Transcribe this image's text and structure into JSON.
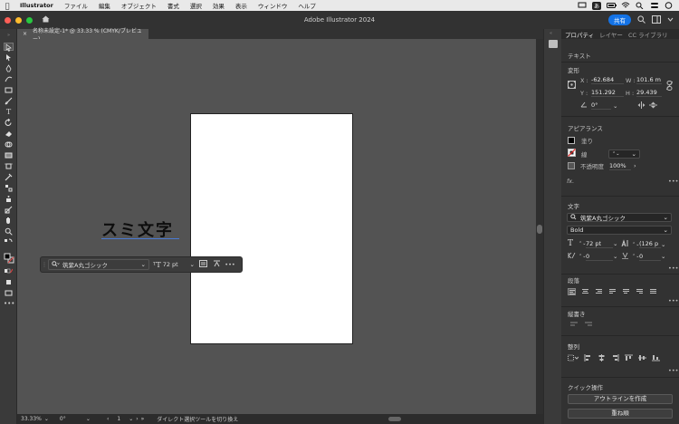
{
  "menubar": {
    "app_name": "Illustrator",
    "items": [
      "ファイル",
      "編集",
      "オブジェクト",
      "書式",
      "選択",
      "効果",
      "表示",
      "ウィンドウ",
      "ヘルプ"
    ],
    "ime": "あ"
  },
  "titlebar": {
    "title": "Adobe Illustrator 2024",
    "share_label": "共有"
  },
  "document": {
    "tab_label": "名称未設定-1* @ 33.33 % (CMYK/プレビュー)",
    "text_content": "スミ文字"
  },
  "context_bar": {
    "font_name": "筑紫A丸ゴシック",
    "font_size": "72 pt"
  },
  "statusbar": {
    "zoom": "33.33%",
    "rotation": "0°",
    "artboard_number": "1",
    "status_text": "ダイレクト選択ツールを切り換え"
  },
  "panel": {
    "tabs": [
      "プロパティ",
      "レイヤー",
      "CC ライブラリ"
    ],
    "object_type": "テキスト",
    "transform": {
      "title": "変形",
      "x_label": "X :",
      "x_value": "-62.684",
      "y_label": "Y :",
      "y_value": "151.292",
      "w_label": "W :",
      "w_value": "101.6 m",
      "h_label": "H :",
      "h_value": "29.439",
      "angle_value": "0°"
    },
    "appearance": {
      "title": "アピアランス",
      "fill_label": "塗り",
      "stroke_label": "線",
      "opacity_label": "不透明度",
      "opacity_value": "100%",
      "fx_label": "fx."
    },
    "character": {
      "title": "文字",
      "font_name": "筑紫A丸ゴシック",
      "font_style": "Bold",
      "size_value": "72 pt",
      "leading_value": "(126 p",
      "tracking_value": "0",
      "kerning_value": "0"
    },
    "paragraph": {
      "title": "段落"
    },
    "vertical_text": {
      "title": "縦書き"
    },
    "align": {
      "title": "整列"
    },
    "quick_actions": {
      "title": "クイック操作",
      "outline_button": "アウトラインを作成",
      "arrange_button": "重ね順"
    }
  },
  "colors": {
    "accent": "#1473e6",
    "canvas": "#535353",
    "panel": "#323232",
    "fill_swatch": "#000000"
  }
}
